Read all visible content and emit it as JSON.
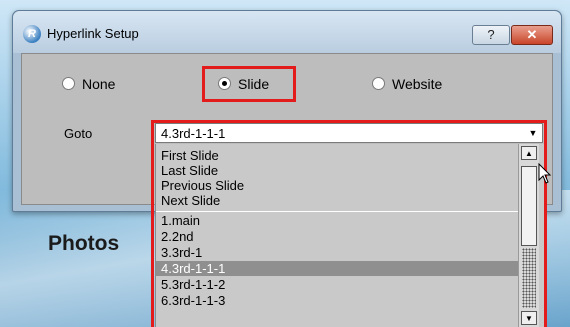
{
  "dialog": {
    "title": "Hyperlink Setup",
    "help_label": "?",
    "close_label": "✕"
  },
  "link_type": {
    "options": [
      {
        "label": "None",
        "checked": false
      },
      {
        "label": "Slide",
        "checked": true
      },
      {
        "label": "Website",
        "checked": false
      }
    ]
  },
  "goto": {
    "label": "Goto",
    "selected_value": "4.3rd-1-1-1",
    "items": [
      "First Slide",
      "Last Slide",
      "Previous Slide",
      "Next Slide",
      "1.main",
      "2.2nd",
      "3.3rd-1",
      "4.3rd-1-1-1",
      "5.3rd-1-1-2",
      "6.3rd-1-1-3"
    ],
    "highlighted_item": "4.3rd-1-1-1"
  },
  "background": {
    "label": "Photos"
  },
  "colors": {
    "highlight_outline": "#e41b1b",
    "selection": "#8f8f8f"
  }
}
